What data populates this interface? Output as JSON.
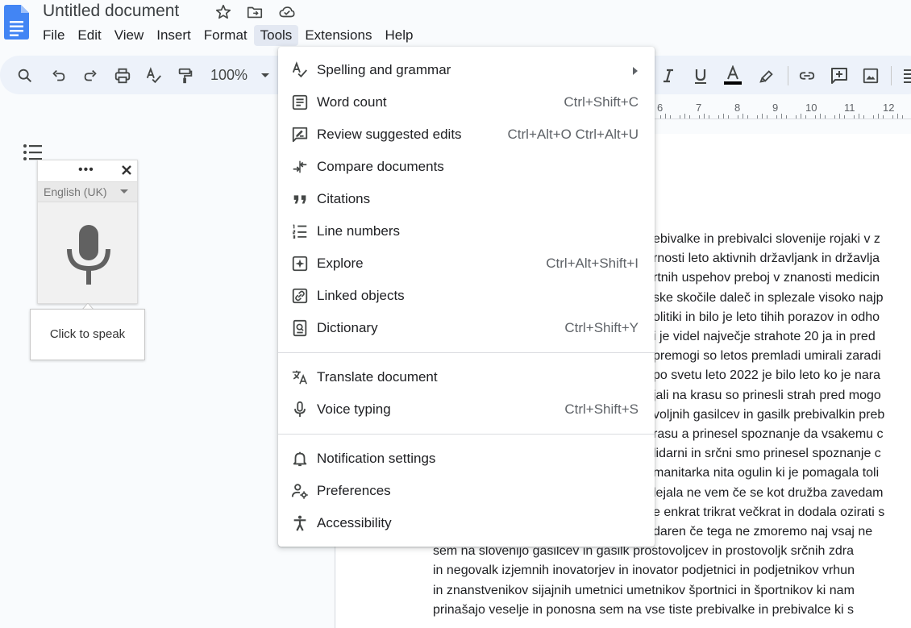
{
  "document": {
    "title": "Untitled document"
  },
  "menubar": {
    "items": [
      "File",
      "Edit",
      "View",
      "Insert",
      "Format",
      "Tools",
      "Extensions",
      "Help"
    ],
    "active": "Tools"
  },
  "toolbar": {
    "zoom": "100%"
  },
  "ruler": {
    "labels": [
      "6",
      "7",
      "8",
      "9",
      "10",
      "11",
      "12"
    ]
  },
  "voice_typing": {
    "language": "English (UK)",
    "tooltip": "Click to speak"
  },
  "tools_menu": {
    "items": [
      {
        "label": "Spelling and grammar",
        "shortcut": "",
        "icon": "spellcheck-icon",
        "submenu": true
      },
      {
        "label": "Word count",
        "shortcut": "Ctrl+Shift+C",
        "icon": "word-count-icon"
      },
      {
        "label": "Review suggested edits",
        "shortcut": "Ctrl+Alt+O Ctrl+Alt+U",
        "icon": "review-edits-icon"
      },
      {
        "label": "Compare documents",
        "shortcut": "",
        "icon": "compare-icon"
      },
      {
        "label": "Citations",
        "shortcut": "",
        "icon": "quote-icon"
      },
      {
        "label": "Line numbers",
        "shortcut": "",
        "icon": "line-numbers-icon"
      },
      {
        "label": "Explore",
        "shortcut": "Ctrl+Alt+Shift+I",
        "icon": "explore-icon"
      },
      {
        "label": "Linked objects",
        "shortcut": "",
        "icon": "linked-objects-icon"
      },
      {
        "label": "Dictionary",
        "shortcut": "Ctrl+Shift+Y",
        "icon": "dictionary-icon"
      },
      {
        "label": "Translate document",
        "shortcut": "",
        "icon": "translate-icon"
      },
      {
        "label": "Voice typing",
        "shortcut": "Ctrl+Shift+S",
        "icon": "mic-icon"
      },
      {
        "label": "Notification settings",
        "shortcut": "",
        "icon": "bell-icon"
      },
      {
        "label": "Preferences",
        "shortcut": "",
        "icon": "preferences-icon"
      },
      {
        "label": "Accessibility",
        "shortcut": "",
        "icon": "accessibility-icon"
      }
    ]
  },
  "body_lines": [
    "ebivalke in prebivalci slovenije rojaki v z",
    "rnosti leto aktivnih državljank in državlja",
    "rtnih uspehov preboj v znanosti medicin",
    "ske skočile daleč in splezale visoko najp",
    "olitiki in bilo je leto tihih porazov in odho",
    "i je videl največje strahote 20 ja in pred",
    "premogi so letos premladi umirali zaradi",
    "po svetu leto 2022 je bilo leto ko je nara",
    "jali na krasu so prinesli strah pred mogo",
    "voljnih gasilcev in gasilk prebivalkin preb",
    "rasu a prinesel spoznanje da vsakemu c",
    "lidarni in srčni smo prinesel spoznanje c",
    "manitarka nita ogulin ki je pomagala toli",
    "lejala ne vem če se kot družba zavedam",
    "e enkrat trikrat večkrat in dodala ozirati s",
    "daren če tega ne zmoremo naj vsaj ne",
    "sem na slovenijo gasilcev in gasilk prostovoljcev in prostovoljk srčnih zdra",
    "in negovalk izjemnih inovatorjev in inovator podjetnici in podjetnikov vrhun",
    "in znanstvenikov sijajnih umetnici umetnikov športnici in športnikov ki nam",
    "prinašajo veselje in ponosna sem na vse tiste prebivalke in prebivalce ki s"
  ]
}
